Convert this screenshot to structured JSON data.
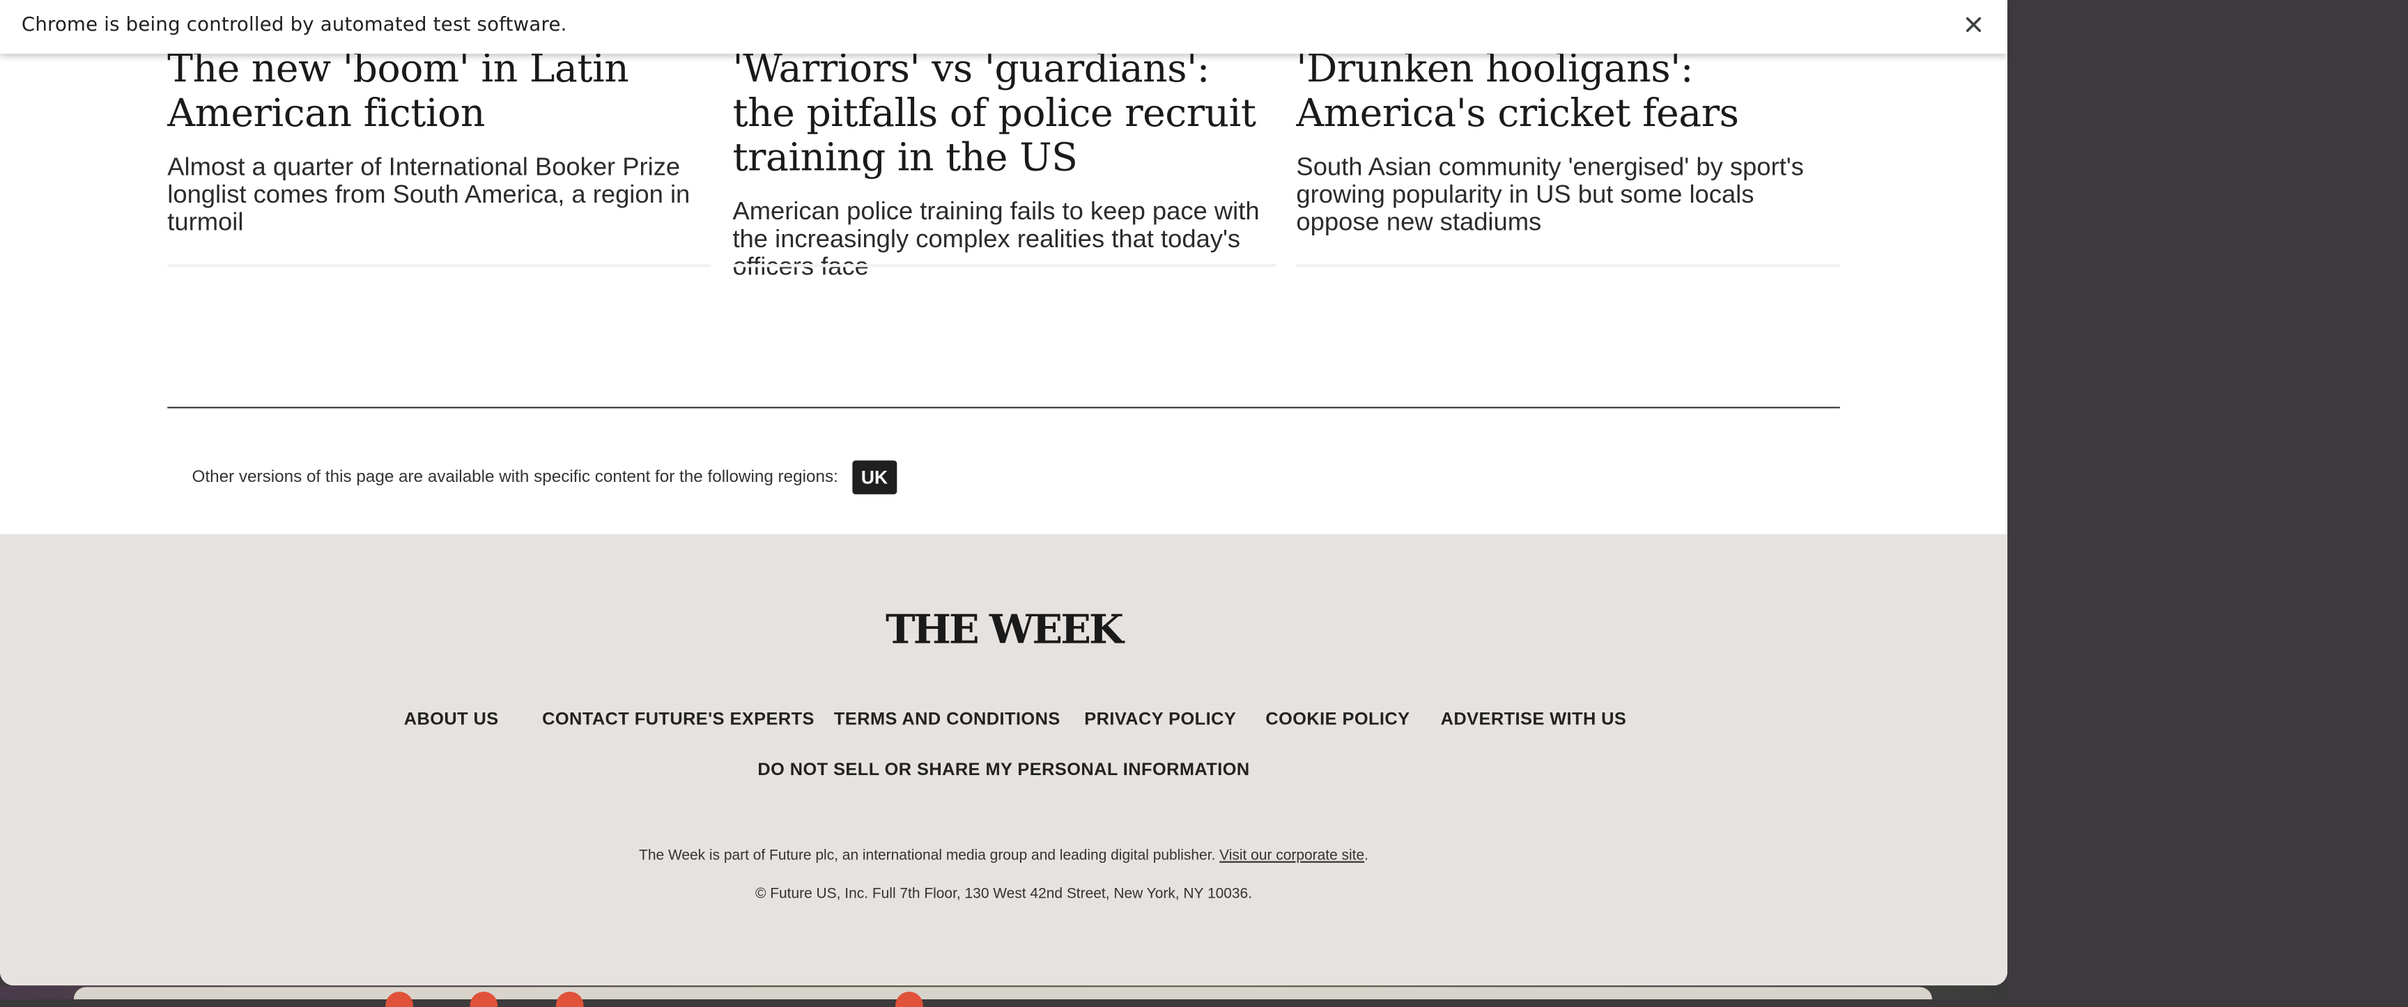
{
  "infobar": {
    "message": "Chrome is being controlled by automated test software.",
    "close_icon": "close-icon"
  },
  "articles": [
    {
      "title": "The new 'boom' in Latin American fiction",
      "standfirst": "Almost a quarter of International Booker Prize longlist comes from South America, a region in turmoil"
    },
    {
      "title": "'Warriors' vs 'guardians': the pitfalls of police recruit training in the US",
      "standfirst": "American police training fails to keep pace with the increasingly complex realities that today's officers face"
    },
    {
      "title": "'Drunken hooligans': America's cricket fears",
      "standfirst": "South Asian community 'energised' by sport's growing popularity in US but some locals oppose new stadiums"
    }
  ],
  "regions": {
    "text": "Other versions of this page are available with specific content for the following regions:",
    "uk_label": "UK"
  },
  "footer": {
    "logo": "THE WEEK",
    "links": [
      "ABOUT US",
      "CONTACT FUTURE'S EXPERTS",
      "TERMS AND CONDITIONS",
      "PRIVACY POLICY",
      "COOKIE POLICY",
      "ADVERTISE WITH US"
    ],
    "dnsmpi": "DO NOT SELL OR SHARE MY PERSONAL INFORMATION",
    "legal_text": "The Week is part of Future plc, an international media group and leading digital publisher.",
    "corporate_link": "Visit our corporate site",
    "legal_end": ".",
    "copyright": "© Future US, Inc. Full 7th Floor, 130 West 42nd Street, New York, NY 10036."
  }
}
